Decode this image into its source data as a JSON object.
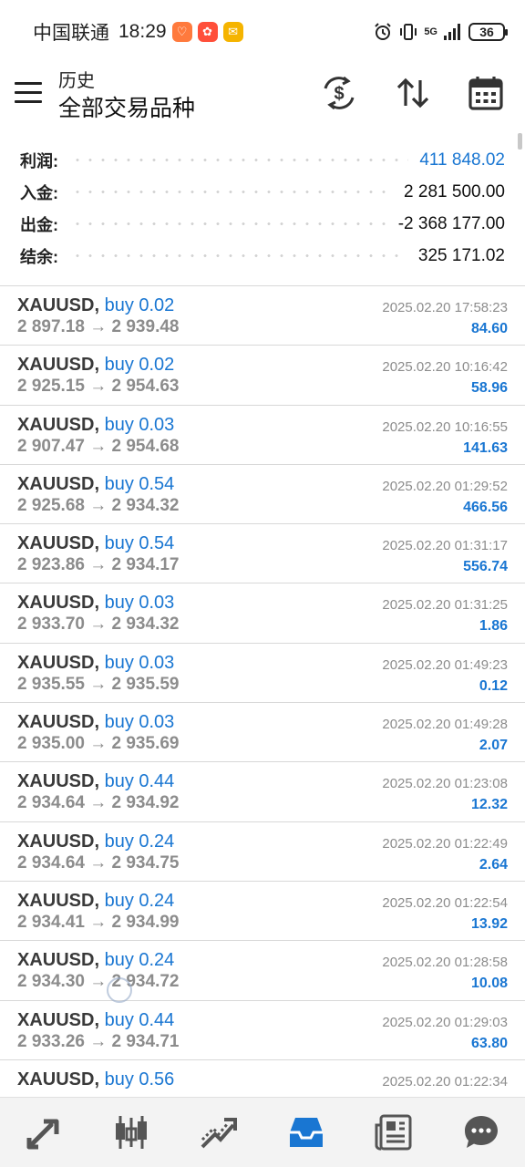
{
  "status_bar": {
    "carrier": "中国联通",
    "time": "18:29",
    "network": "5G",
    "battery": "36"
  },
  "header": {
    "title": "历史",
    "subtitle": "全部交易品种"
  },
  "summary": [
    {
      "label": "利润:",
      "value": "411 848.02",
      "highlight": true
    },
    {
      "label": "入金:",
      "value": "2 281 500.00",
      "highlight": false
    },
    {
      "label": "出金:",
      "value": "-2 368 177.00",
      "highlight": false
    },
    {
      "label": "结余:",
      "value": "325 171.02",
      "highlight": false
    }
  ],
  "trades": [
    {
      "symbol": "XAUUSD,",
      "side": "buy 0.02",
      "prices": "2 897.18 → 2 939.48",
      "datetime": "2025.02.20 17:58:23",
      "profit": "84.60"
    },
    {
      "symbol": "XAUUSD,",
      "side": "buy 0.02",
      "prices": "2 925.15 → 2 954.63",
      "datetime": "2025.02.20 10:16:42",
      "profit": "58.96"
    },
    {
      "symbol": "XAUUSD,",
      "side": "buy 0.03",
      "prices": "2 907.47 → 2 954.68",
      "datetime": "2025.02.20 10:16:55",
      "profit": "141.63"
    },
    {
      "symbol": "XAUUSD,",
      "side": "buy 0.54",
      "prices": "2 925.68 → 2 934.32",
      "datetime": "2025.02.20 01:29:52",
      "profit": "466.56"
    },
    {
      "symbol": "XAUUSD,",
      "side": "buy 0.54",
      "prices": "2 923.86 → 2 934.17",
      "datetime": "2025.02.20 01:31:17",
      "profit": "556.74"
    },
    {
      "symbol": "XAUUSD,",
      "side": "buy 0.03",
      "prices": "2 933.70 → 2 934.32",
      "datetime": "2025.02.20 01:31:25",
      "profit": "1.86"
    },
    {
      "symbol": "XAUUSD,",
      "side": "buy 0.03",
      "prices": "2 935.55 → 2 935.59",
      "datetime": "2025.02.20 01:49:23",
      "profit": "0.12"
    },
    {
      "symbol": "XAUUSD,",
      "side": "buy 0.03",
      "prices": "2 935.00 → 2 935.69",
      "datetime": "2025.02.20 01:49:28",
      "profit": "2.07"
    },
    {
      "symbol": "XAUUSD,",
      "side": "buy 0.44",
      "prices": "2 934.64 → 2 934.92",
      "datetime": "2025.02.20 01:23:08",
      "profit": "12.32"
    },
    {
      "symbol": "XAUUSD,",
      "side": "buy 0.24",
      "prices": "2 934.64 → 2 934.75",
      "datetime": "2025.02.20 01:22:49",
      "profit": "2.64"
    },
    {
      "symbol": "XAUUSD,",
      "side": "buy 0.24",
      "prices": "2 934.41 → 2 934.99",
      "datetime": "2025.02.20 01:22:54",
      "profit": "13.92"
    },
    {
      "symbol": "XAUUSD,",
      "side": "buy 0.24",
      "prices": "2 934.30 → 2 934.72",
      "datetime": "2025.02.20 01:28:58",
      "profit": "10.08"
    },
    {
      "symbol": "XAUUSD,",
      "side": "buy 0.44",
      "prices": "2 933.26 → 2 934.71",
      "datetime": "2025.02.20 01:29:03",
      "profit": "63.80"
    },
    {
      "symbol": "XAUUSD,",
      "side": "buy 0.56",
      "prices": "",
      "datetime": "2025.02.20 01:22:34",
      "profit": ""
    }
  ],
  "bottom_nav": [
    {
      "icon": "quotes-icon"
    },
    {
      "icon": "chart-icon"
    },
    {
      "icon": "trade-icon"
    },
    {
      "icon": "history-icon",
      "active": true
    },
    {
      "icon": "news-icon"
    },
    {
      "icon": "chat-icon"
    }
  ],
  "colors": {
    "accent": "#1976d2",
    "muted_text": "#8c8c8c",
    "nav_background": "#f3f3f3"
  }
}
